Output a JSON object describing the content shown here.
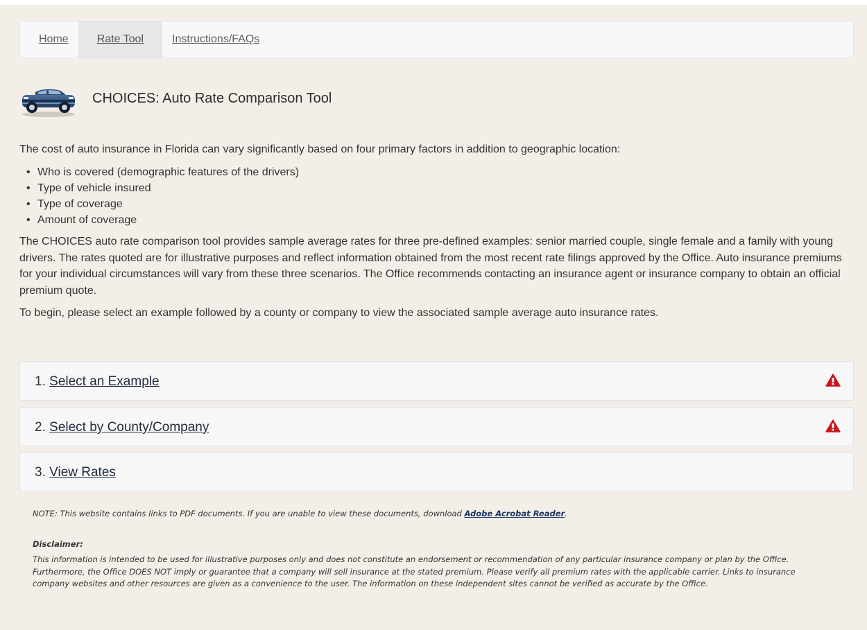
{
  "nav": {
    "items": [
      {
        "label": "Home"
      },
      {
        "label": "Rate Tool"
      },
      {
        "label": "Instructions/FAQs"
      }
    ]
  },
  "header": {
    "icon": "car-icon",
    "title": "CHOICES: Auto Rate Comparison Tool"
  },
  "intro": {
    "lead": "The cost of auto insurance in Florida can vary significantly based on four primary factors in addition to geographic location:",
    "factors": [
      "Who is covered (demographic features of the drivers)",
      "Type of vehicle insured",
      "Type of coverage",
      "Amount of coverage"
    ],
    "description": "The CHOICES auto rate comparison tool provides sample average rates for three pre-defined examples: senior married couple, single female and a family with young drivers. The rates quoted are for illustrative purposes and reflect information obtained from the most recent rate filings approved by the Office. Auto insurance premiums for your individual circumstances will vary from these three scenarios. The Office recommends contacting an insurance agent or insurance company to obtain an official premium quote.",
    "instruction": "To begin, please select an example followed by a county or company to view the associated sample average auto insurance rates."
  },
  "steps": [
    {
      "number": "1.",
      "label": "Select an Example",
      "warning_icon": "warning-icon"
    },
    {
      "number": "2.",
      "label": "Select by County/Company",
      "warning_icon": "warning-icon"
    },
    {
      "number": "3.",
      "label": "View Rates"
    }
  ],
  "note": {
    "text": "NOTE: This website contains links to PDF documents. If you are unable to view these documents, download ",
    "link": "Adobe Acrobat Reader",
    "end": "."
  },
  "disclaimer": {
    "title": "Disclaimer:",
    "text": "This information is intended to be used for illustrative purposes only and does not constitute an endorsement or recommendation of any particular insurance company or plan by the Office. Furthermore, the Office DOES NOT imply or guarantee that a company will sell insurance at the stated premium. Please verify all premium rates with the applicable carrier. Links to insurance company websites and other resources are given as a convenience to the user. The information on these independent sites cannot be verified as accurate by the Office."
  },
  "colors": {
    "page_background": "#f3efe8",
    "link": "#222d3f",
    "warning": "#c8161d",
    "car": "#2c4a73"
  }
}
